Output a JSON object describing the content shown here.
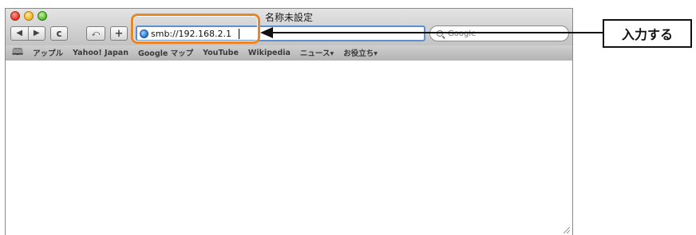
{
  "window": {
    "title": "名称未設定"
  },
  "toolbar": {
    "back_label": "◀",
    "forward_label": "▶",
    "reload_label": "c",
    "snapback_label": "⤺",
    "add_bookmark_label": "+"
  },
  "address_bar": {
    "value": "smb://192.168.2.1",
    "icon": "globe-icon"
  },
  "search": {
    "placeholder": "Google"
  },
  "bookmarks": {
    "items": [
      {
        "label": "アップル"
      },
      {
        "label": "Yahoo! Japan"
      },
      {
        "label": "Google マップ"
      },
      {
        "label": "YouTube"
      },
      {
        "label": "Wikipedia"
      },
      {
        "label": "ニュース▾"
      },
      {
        "label": "お役立ち▾"
      }
    ]
  },
  "annotation": {
    "label": "入力する",
    "highlight_color": "#e8862a"
  }
}
